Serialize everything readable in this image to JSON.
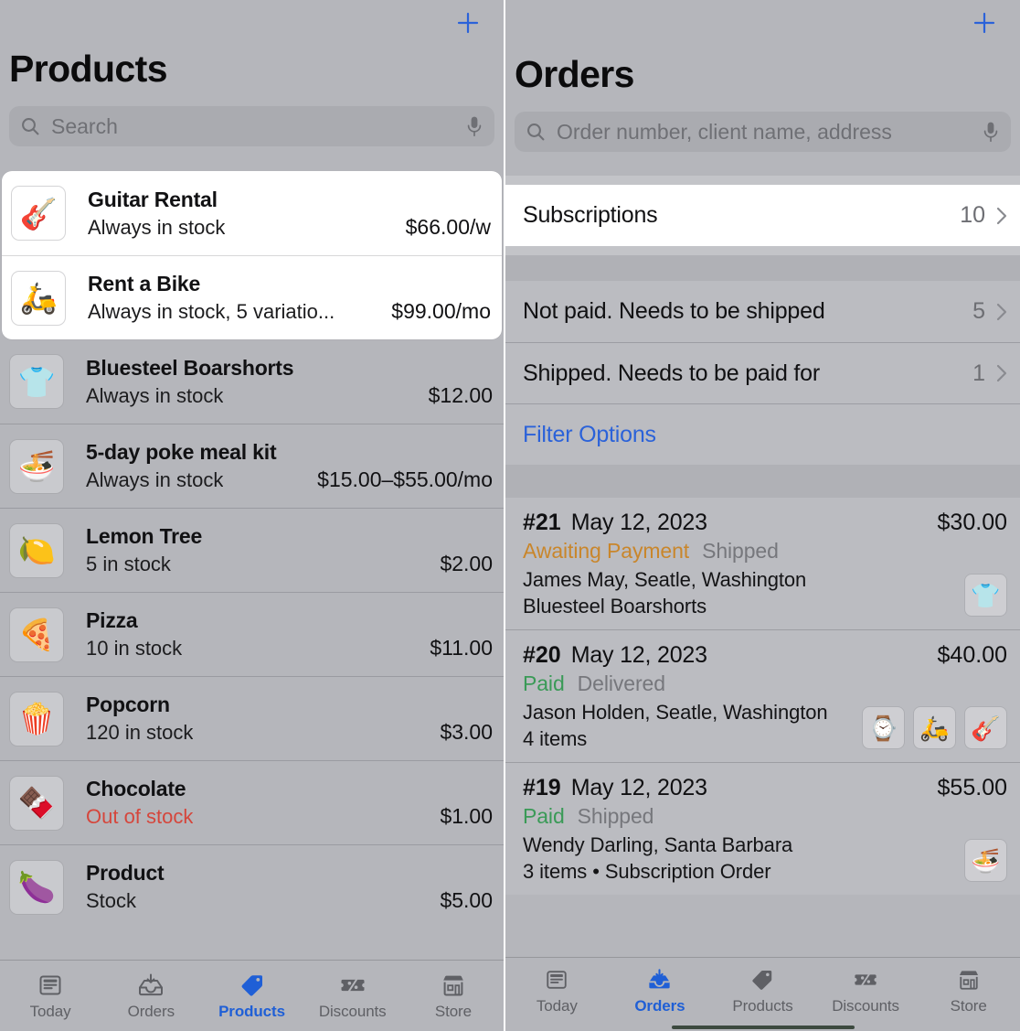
{
  "products_pane": {
    "add_button_icon": "plus-icon",
    "title": "Products",
    "search": {
      "placeholder": "Search",
      "value": "",
      "icon": "search-icon",
      "mic_icon": "microphone-icon"
    },
    "featured_group": [
      {
        "emoji": "🎸",
        "icon_name": "guitar-emoji",
        "name": "Guitar Rental",
        "stock": "Always in stock",
        "price": "$66.00/w",
        "out_of_stock": false
      },
      {
        "emoji": "🛵",
        "icon_name": "scooter-emoji",
        "name": "Rent a Bike",
        "stock": "Always in stock, 5 variatio...",
        "price": "$99.00/mo",
        "out_of_stock": false
      }
    ],
    "list_group": [
      {
        "emoji": "👕",
        "icon_name": "tshirt-emoji",
        "name": "Bluesteel Boarshorts",
        "stock": "Always in stock",
        "price": "$12.00",
        "out_of_stock": false
      },
      {
        "emoji": "🍜",
        "icon_name": "bowl-emoji",
        "name": "5-day poke meal kit",
        "stock": "Always in stock",
        "price": "$15.00–$55.00/mo",
        "out_of_stock": false
      },
      {
        "emoji": "🍋",
        "icon_name": "lemon-emoji",
        "name": "Lemon Tree",
        "stock": "5 in stock",
        "price": "$2.00",
        "out_of_stock": false
      },
      {
        "emoji": "🍕",
        "icon_name": "pizza-emoji",
        "name": "Pizza",
        "stock": "10 in stock",
        "price": "$11.00",
        "out_of_stock": false
      },
      {
        "emoji": "🍿",
        "icon_name": "popcorn-emoji",
        "name": "Popcorn",
        "stock": "120 in stock",
        "price": "$3.00",
        "out_of_stock": false
      },
      {
        "emoji": "🍫",
        "icon_name": "chocolate-emoji",
        "name": "Chocolate",
        "stock": "Out of stock",
        "price": "$1.00",
        "out_of_stock": true
      },
      {
        "emoji": "🍆",
        "icon_name": "eggplant-emoji",
        "name": "Product",
        "stock": "Stock",
        "price": "$5.00",
        "out_of_stock": false
      }
    ],
    "tabs": [
      {
        "label": "Today",
        "icon": "today-icon",
        "active": false
      },
      {
        "label": "Orders",
        "icon": "orders-tray-icon",
        "active": false
      },
      {
        "label": "Products",
        "icon": "tag-icon",
        "active": true
      },
      {
        "label": "Discounts",
        "icon": "discount-ticket-icon",
        "active": false
      },
      {
        "label": "Store",
        "icon": "storefront-icon",
        "active": false
      }
    ]
  },
  "orders_pane": {
    "add_button_icon": "plus-icon",
    "title": "Orders",
    "search": {
      "placeholder": "Order number, client name, address",
      "value": "",
      "icon": "search-icon",
      "mic_icon": "microphone-icon"
    },
    "subscriptions_group": [
      {
        "label": "Subscriptions",
        "count": "10",
        "chevron": "chevron-right-icon"
      }
    ],
    "filters_group": [
      {
        "label": "Not paid. Needs to be shipped",
        "count": "5",
        "chevron": "chevron-right-icon"
      },
      {
        "label": "Shipped. Needs to be paid for",
        "count": "1",
        "chevron": "chevron-right-icon"
      }
    ],
    "filter_options_label": "Filter Options",
    "orders": [
      {
        "number": "#21",
        "date": "May 12, 2023",
        "total": "$30.00",
        "payment_status": "Awaiting Payment",
        "payment_state": "awaiting",
        "fulfillment_status": "Shipped",
        "client": "James May, Seatle, Washington",
        "items": "Bluesteel Boarshorts",
        "thumbs": [
          {
            "emoji": "👕",
            "icon_name": "tshirt-emoji"
          }
        ]
      },
      {
        "number": "#20",
        "date": "May 12, 2023",
        "total": "$40.00",
        "payment_status": "Paid",
        "payment_state": "paid",
        "fulfillment_status": "Delivered",
        "client": "Jason Holden, Seatle, Washington",
        "items": "4 items",
        "thumbs": [
          {
            "emoji": "⌚",
            "icon_name": "watch-emoji"
          },
          {
            "emoji": "🛵",
            "icon_name": "scooter-emoji"
          },
          {
            "emoji": "🎸",
            "icon_name": "guitar-emoji"
          }
        ]
      },
      {
        "number": "#19",
        "date": "May 12, 2023",
        "total": "$55.00",
        "payment_status": "Paid",
        "payment_state": "paid",
        "fulfillment_status": "Shipped",
        "client": "Wendy Darling, Santa Barbara",
        "items": "3 items • Subscription Order",
        "thumbs": [
          {
            "emoji": "🍜",
            "icon_name": "bowl-emoji"
          }
        ]
      }
    ],
    "tabs": [
      {
        "label": "Today",
        "icon": "today-icon",
        "active": false
      },
      {
        "label": "Orders",
        "icon": "orders-tray-icon",
        "active": true
      },
      {
        "label": "Products",
        "icon": "tag-icon",
        "active": false
      },
      {
        "label": "Discounts",
        "icon": "discount-ticket-icon",
        "active": false
      },
      {
        "label": "Store",
        "icon": "storefront-icon",
        "active": false
      }
    ]
  },
  "colors": {
    "accent_blue": "#2b62d9",
    "paid_green": "#3a9a57",
    "awaiting_orange": "#c9862b",
    "out_of_stock_red": "#d5463c",
    "background_gray": "#b5b6bb"
  }
}
